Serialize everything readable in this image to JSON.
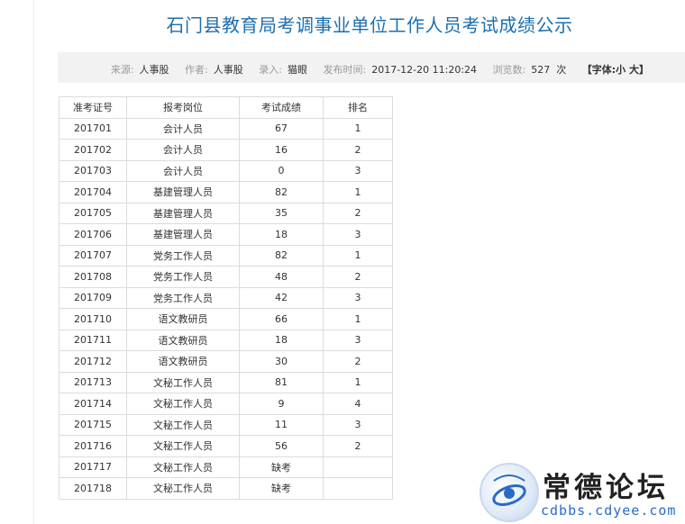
{
  "page": {
    "title": "石门县教育局考调事业单位工作人员考试成绩公示"
  },
  "meta": {
    "source_label": "来源:",
    "source": "人事股",
    "author_label": "作者:",
    "author": "人事股",
    "entry_label": "录入:",
    "entry": "猫眼",
    "time_label": "发布时间:",
    "time": "2017-12-20 11:20:24",
    "views_label": "浏览数:",
    "views": "527",
    "views_unit": "次",
    "font_prefix": "【字体:",
    "font_small": "小",
    "font_large": "大",
    "font_suffix": "】"
  },
  "table": {
    "headers": [
      "准考证号",
      "报考岗位",
      "考试成绩",
      "排名"
    ],
    "rows": [
      [
        "201701",
        "会计人员",
        "67",
        "1"
      ],
      [
        "201702",
        "会计人员",
        "16",
        "2"
      ],
      [
        "201703",
        "会计人员",
        "0",
        "3"
      ],
      [
        "201704",
        "基建管理人员",
        "82",
        "1"
      ],
      [
        "201705",
        "基建管理人员",
        "35",
        "2"
      ],
      [
        "201706",
        "基建管理人员",
        "18",
        "3"
      ],
      [
        "201707",
        "党务工作人员",
        "82",
        "1"
      ],
      [
        "201708",
        "党务工作人员",
        "48",
        "2"
      ],
      [
        "201709",
        "党务工作人员",
        "42",
        "3"
      ],
      [
        "201710",
        "语文教研员",
        "66",
        "1"
      ],
      [
        "201711",
        "语文教研员",
        "18",
        "3"
      ],
      [
        "201712",
        "语文教研员",
        "30",
        "2"
      ],
      [
        "201713",
        "文秘工作人员",
        "81",
        "1"
      ],
      [
        "201714",
        "文秘工作人员",
        "9",
        "4"
      ],
      [
        "201715",
        "文秘工作人员",
        "11",
        "3"
      ],
      [
        "201716",
        "文秘工作人员",
        "56",
        "2"
      ],
      [
        "201717",
        "文秘工作人员",
        "缺考",
        ""
      ],
      [
        "201718",
        "文秘工作人员",
        "缺考",
        ""
      ]
    ]
  },
  "watermark": {
    "name": "常德论坛",
    "url": "cdbbs.cdyee.com",
    "logo_icon": "cdbbs-logo-icon"
  }
}
